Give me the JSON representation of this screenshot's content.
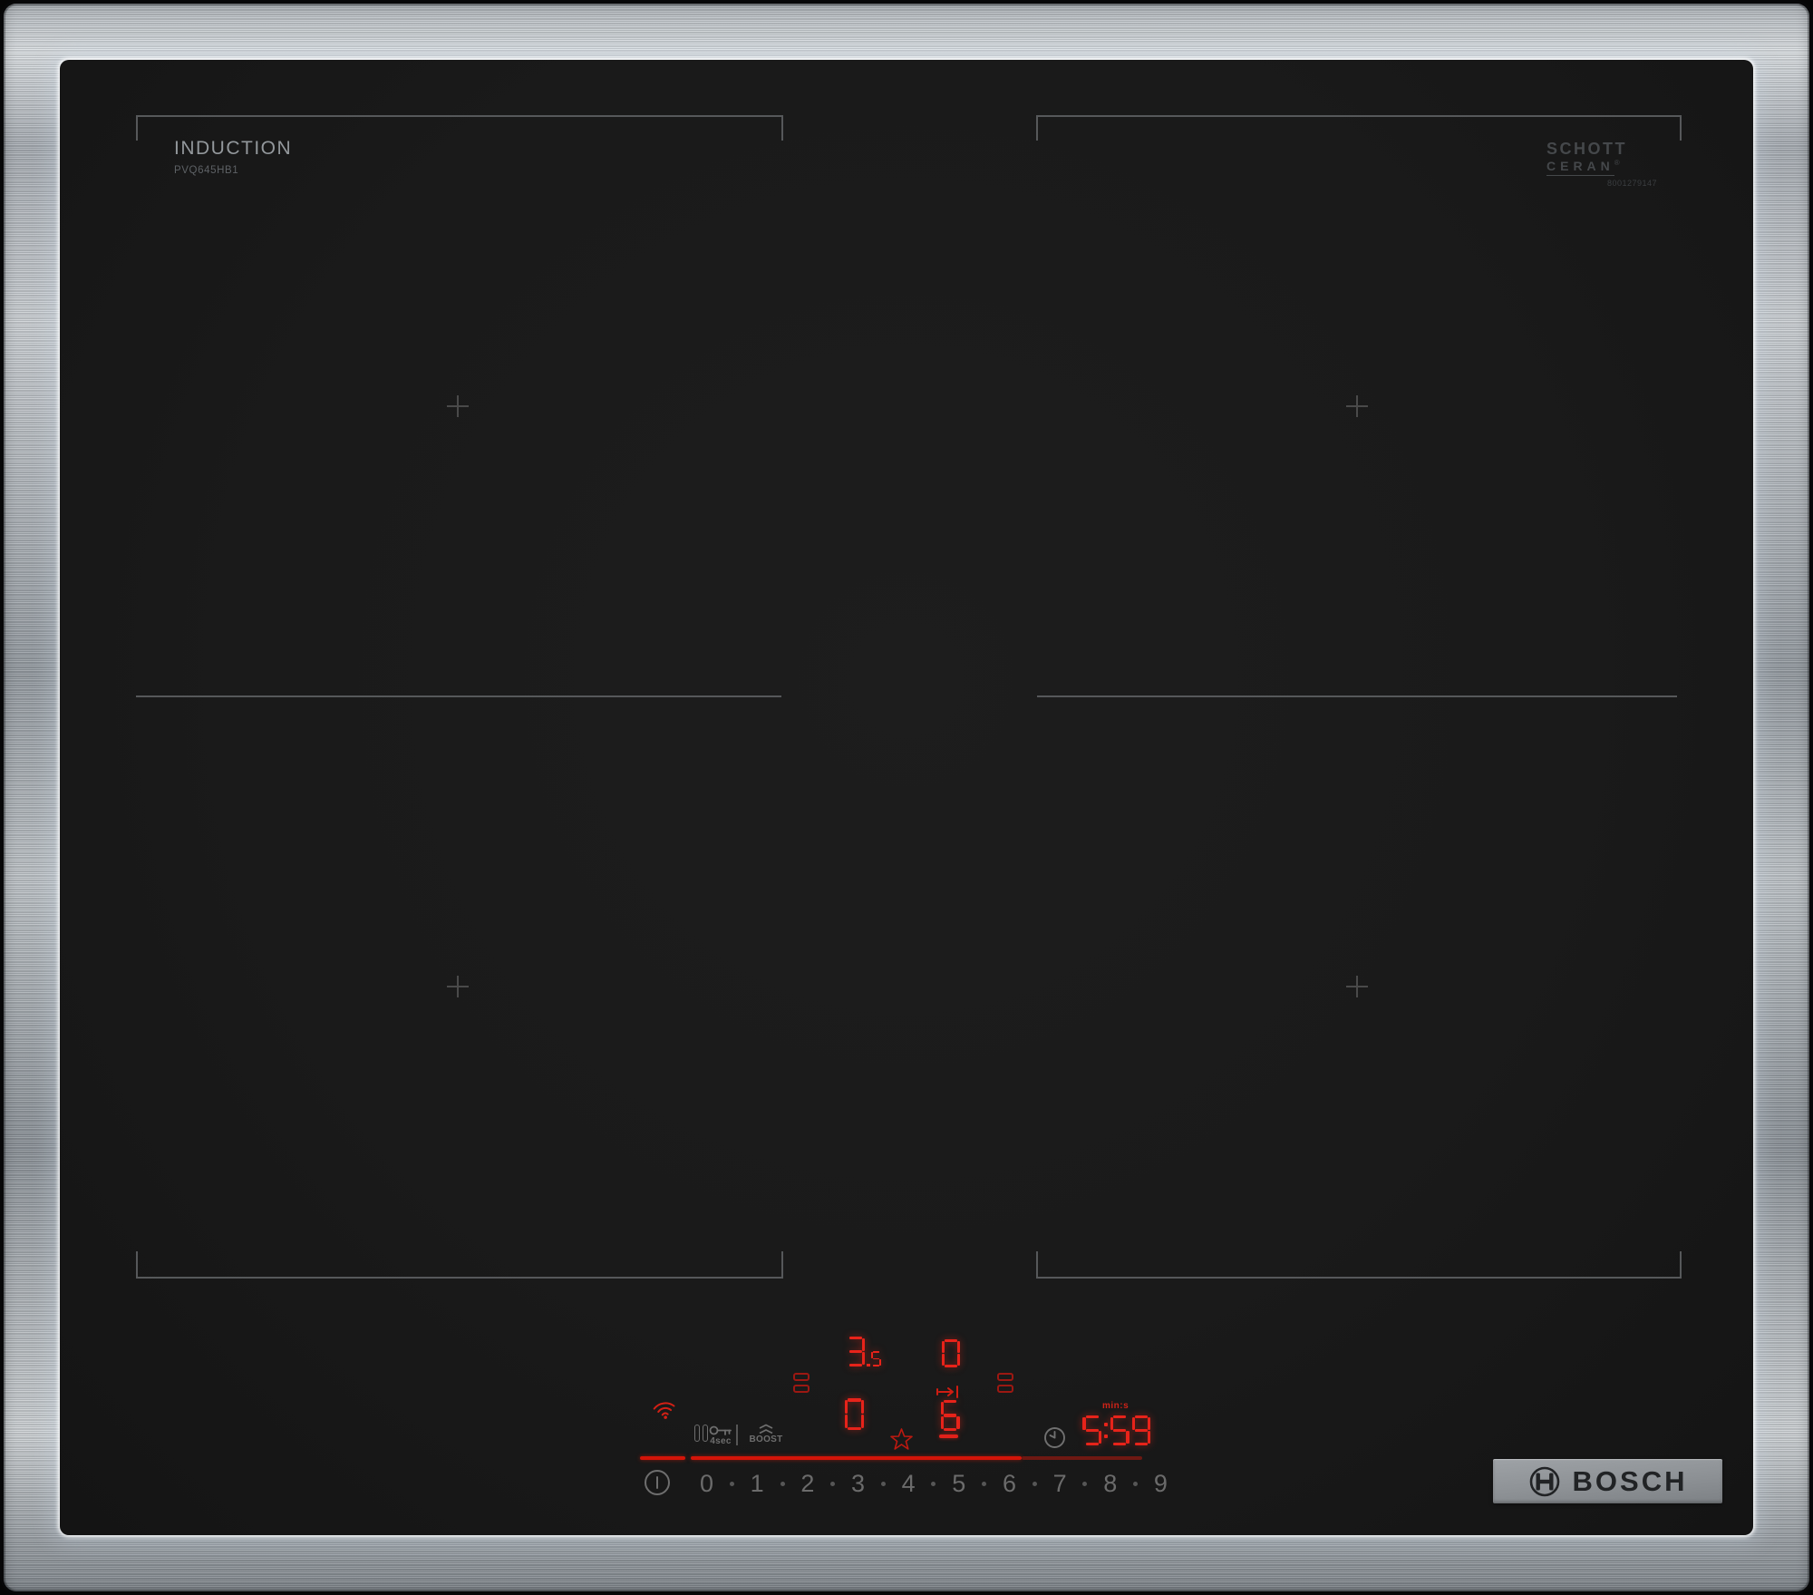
{
  "branding": {
    "surface_label": "INDUCTION",
    "model_number": "PVQ645HB1",
    "glass_maker_line1": "SCHOTT",
    "glass_maker_line2": "CERAN",
    "glass_maker_reg": "®",
    "print_code": "8001279147",
    "manufacturer_logo": "BOSCH"
  },
  "control_panel": {
    "zone_displays": {
      "rear_left": "3.5",
      "rear_right": "0",
      "front_left": "0",
      "front_right": "6"
    },
    "timer": {
      "value": "5:59",
      "unit_label": "min:s"
    },
    "child_lock_label": "4sec",
    "boost_label": "BOOST",
    "power_scale": [
      "0",
      "1",
      "2",
      "3",
      "4",
      "5",
      "6",
      "7",
      "8",
      "9"
    ],
    "colors": {
      "led_red": "#e8231a",
      "track_red": "#d41408",
      "track_dim_red": "#6e1812",
      "icon_gray": "#6e6e6e"
    }
  }
}
